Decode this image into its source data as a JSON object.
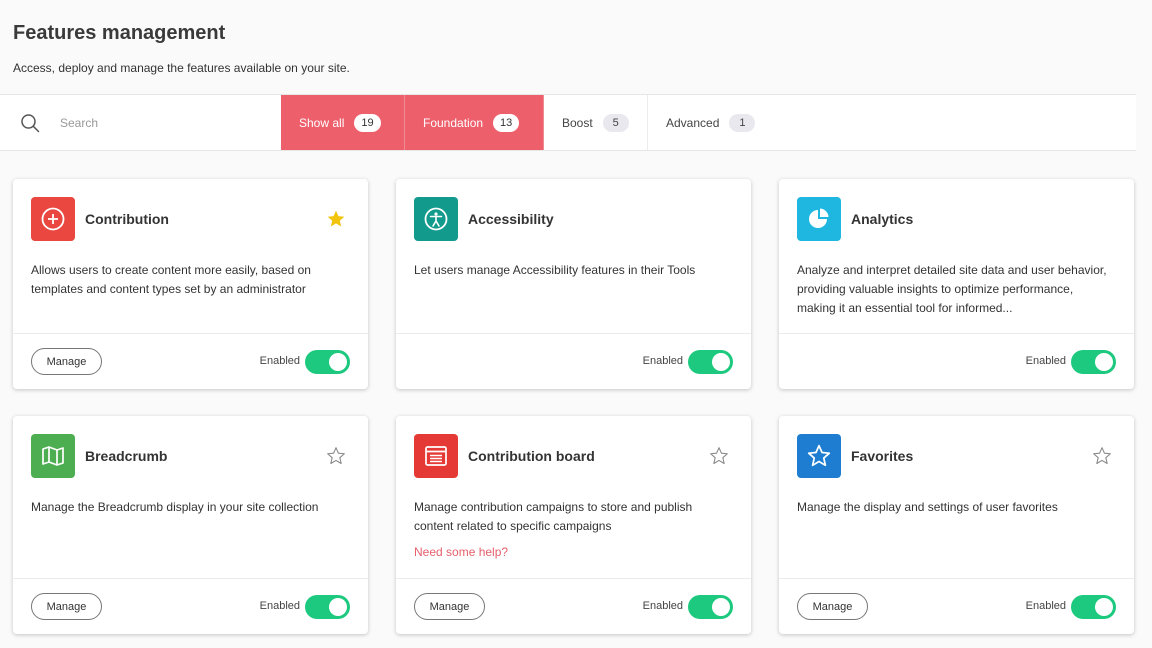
{
  "header": {
    "title": "Features management",
    "subtitle": "Access, deploy and manage the features available on your site."
  },
  "search": {
    "placeholder": "Search"
  },
  "tabs": [
    {
      "label": "Show all",
      "count": "19",
      "active": true
    },
    {
      "label": "Foundation",
      "count": "13",
      "active": true
    },
    {
      "label": "Boost",
      "count": "5",
      "active": false
    },
    {
      "label": "Advanced",
      "count": "1",
      "active": false
    }
  ],
  "cards": [
    {
      "title": "Contribution",
      "icon": "plus-circle-icon",
      "color": "#e9473f",
      "favorite": true,
      "description": "Allows users to create content more easily, based on templates and content types set by an administrator",
      "manage": "Manage",
      "status": "Enabled",
      "enabled": true
    },
    {
      "title": "Accessibility",
      "icon": "accessibility-icon",
      "color": "#129a8c",
      "favorite": false,
      "description": "Let users manage Accessibility features in their Tools",
      "status": "Enabled",
      "enabled": true
    },
    {
      "title": "Analytics",
      "icon": "pie-chart-icon",
      "color": "#1fb7e0",
      "favorite": false,
      "description": "Analyze and interpret detailed site data and user behavior, providing valuable insights to optimize performance, making it an essential tool for informed...",
      "status": "Enabled",
      "enabled": true
    },
    {
      "title": "Breadcrumb",
      "icon": "map-icon",
      "color": "#4cae50",
      "favorite": false,
      "description": "Manage the Breadcrumb display in your site collection",
      "manage": "Manage",
      "status": "Enabled",
      "enabled": true
    },
    {
      "title": "Contribution board",
      "icon": "board-icon",
      "color": "#e53935",
      "favorite": false,
      "description": "Manage contribution campaigns to store and publish content related to specific campaigns",
      "help": "Need some help?",
      "manage": "Manage",
      "status": "Enabled",
      "enabled": true
    },
    {
      "title": "Favorites",
      "icon": "star-icon",
      "color": "#1e7dd0",
      "favorite": false,
      "description": "Manage the display and settings of user favorites",
      "manage": "Manage",
      "status": "Enabled",
      "enabled": true
    }
  ],
  "colors": {
    "accent": "#ee5f6c",
    "toggle_on": "#1cc97e",
    "favorite_star": "#f2c40e",
    "link": "#e4606b"
  }
}
